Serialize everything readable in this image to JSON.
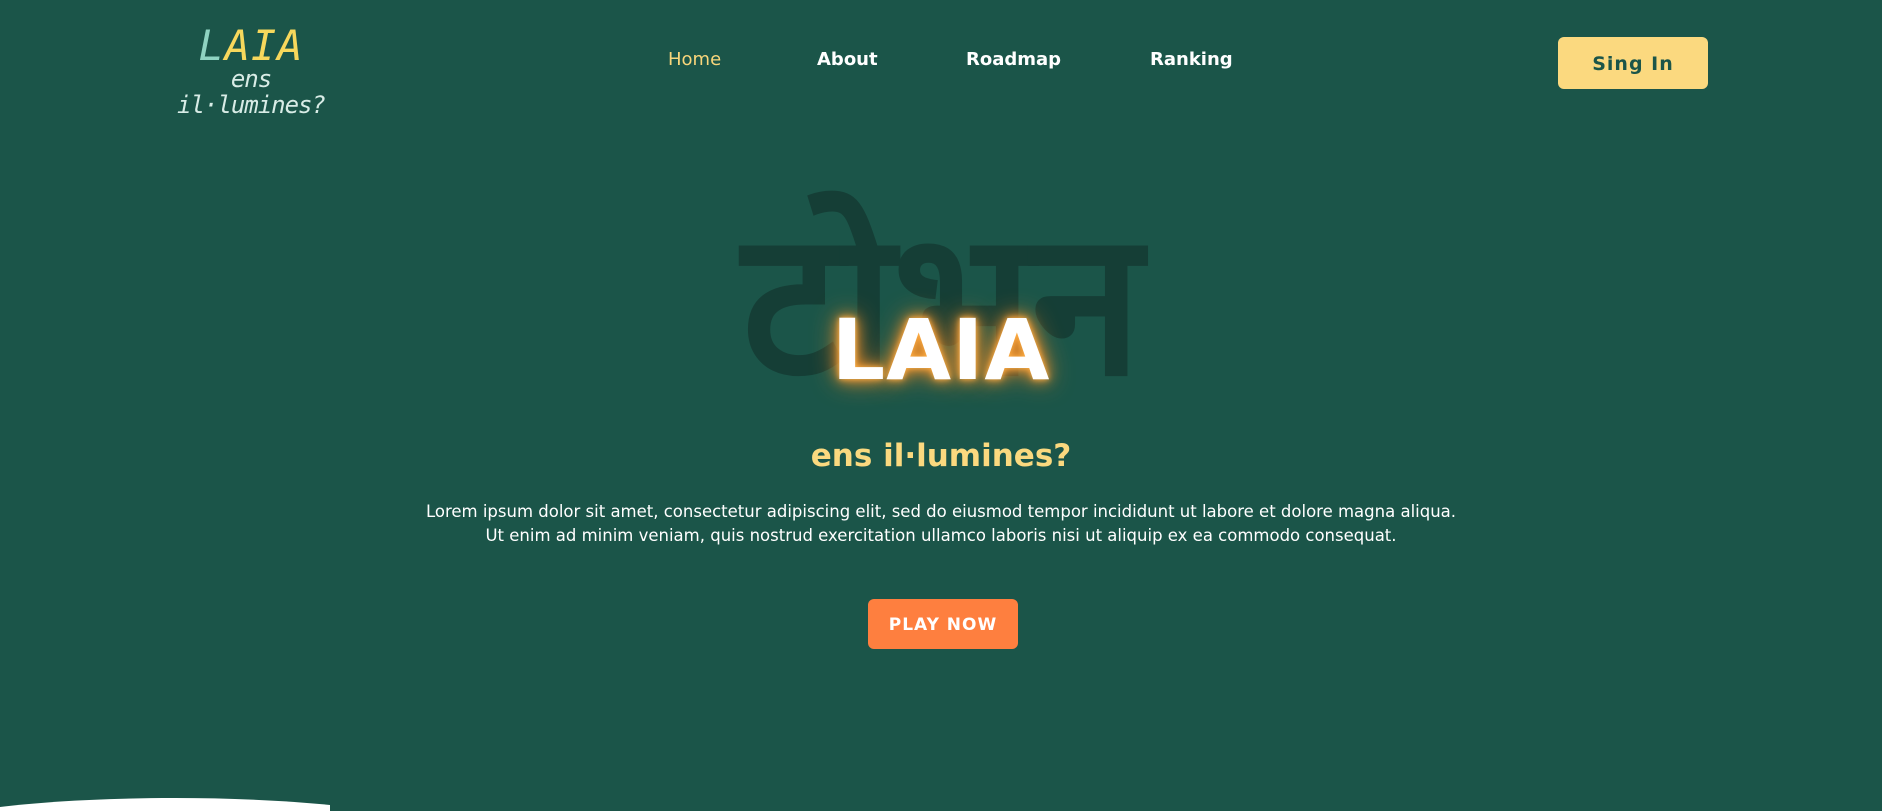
{
  "colors": {
    "background": "#1b5549",
    "accent_yellow": "#fbd97f",
    "accent_orange": "#fe7f3f",
    "logo_teal": "#8fd3c1",
    "logo_yellow": "#f7d85c"
  },
  "logo": {
    "word_part1": "L",
    "word_part2": "AIA",
    "tagline": "ens il·lumines?"
  },
  "nav": {
    "items": [
      {
        "label": "Home",
        "active": true
      },
      {
        "label": "About",
        "active": false
      },
      {
        "label": "Roadmap",
        "active": false
      },
      {
        "label": "Ranking",
        "active": false
      }
    ],
    "signin_label": "Sing In"
  },
  "hero": {
    "background_word": "टोभन",
    "title": "LAIA",
    "subtitle": "ens il·lumines?",
    "text_line1": "Lorem ipsum dolor sit amet, consectetur adipiscing elit, sed do eiusmod tempor incididunt ut labore et dolore magna aliqua.",
    "text_line2": "Ut enim ad minim veniam, quis nostrud exercitation ullamco laboris nisi ut aliquip ex ea commodo consequat.",
    "cta_label": "PLAY NOW"
  }
}
